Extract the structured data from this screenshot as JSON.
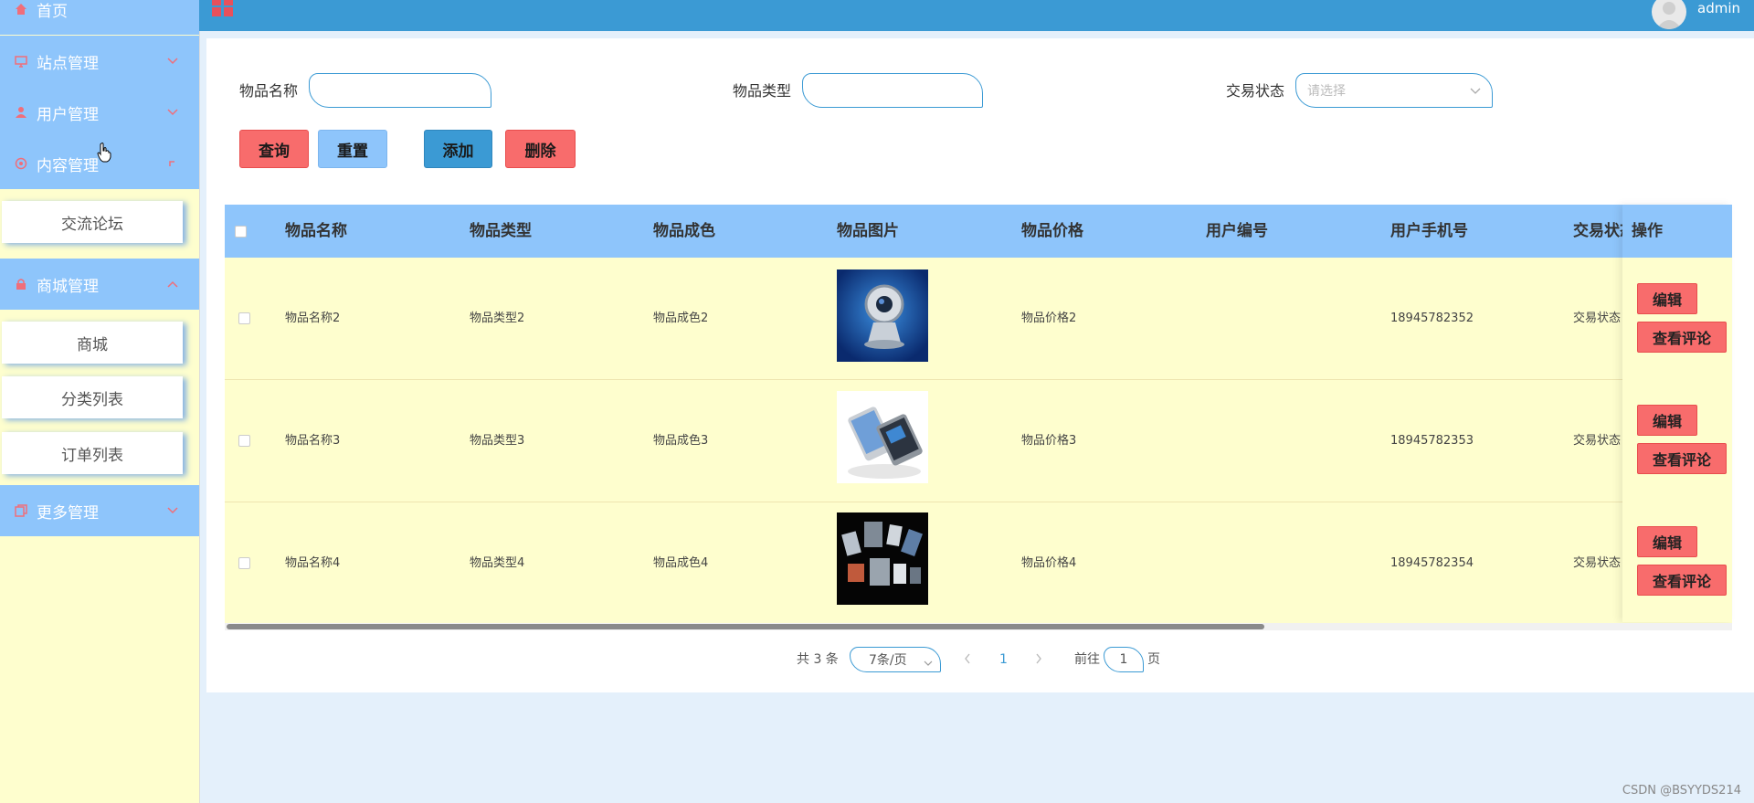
{
  "sidebar": {
    "menu": [
      {
        "label": "首页"
      },
      {
        "label": "站点管理"
      },
      {
        "label": "用户管理"
      },
      {
        "label": "内容管理"
      },
      {
        "label": "商城管理"
      },
      {
        "label": "更多管理"
      }
    ],
    "sub_items": {
      "content": [
        "交流论坛"
      ],
      "mall": [
        "商城",
        "分类列表",
        "订单列表"
      ]
    }
  },
  "header": {
    "user_name": "admin"
  },
  "filters": {
    "item_name_label": "物品名称",
    "item_type_label": "物品类型",
    "trade_status_label": "交易状态",
    "trade_status_placeholder": "请选择",
    "item_name_value": "",
    "item_type_value": ""
  },
  "actions": {
    "query": "查询",
    "reset": "重置",
    "add": "添加",
    "delete": "删除"
  },
  "table": {
    "columns": [
      "物品名称",
      "物品类型",
      "物品成色",
      "物品图片",
      "物品价格",
      "用户编号",
      "用户手机号",
      "交易状态",
      "操作"
    ],
    "rows": [
      {
        "name": "物品名称2",
        "type": "物品类型2",
        "condition": "物品成色2",
        "image": "webcam",
        "price": "物品价格2",
        "user_no": "",
        "phone": "18945782352",
        "status": "交易状态"
      },
      {
        "name": "物品名称3",
        "type": "物品类型3",
        "condition": "物品成色3",
        "image": "phones",
        "price": "物品价格3",
        "user_no": "",
        "phone": "18945782353",
        "status": "交易状态"
      },
      {
        "name": "物品名称4",
        "type": "物品类型4",
        "condition": "物品成色4",
        "image": "devices",
        "price": "物品价格4",
        "user_no": "",
        "phone": "18945782354",
        "status": "交易状态"
      }
    ],
    "row_actions": {
      "edit": "编辑",
      "view_comments": "查看评论"
    }
  },
  "pagination": {
    "total_text": "共 3 条",
    "page_size": "7条/页",
    "current_page": "1",
    "goto_prefix": "前往",
    "goto_value": "1",
    "goto_suffix": "页"
  },
  "watermark": "CSDN @BSYYDS214",
  "colors": {
    "sidebar_bg": "#fefece",
    "menu_bg": "#8ec5fb",
    "topbar_bg": "#3b9ad4",
    "danger": "#f86c6c",
    "accent_blue": "#3b9ad4"
  }
}
